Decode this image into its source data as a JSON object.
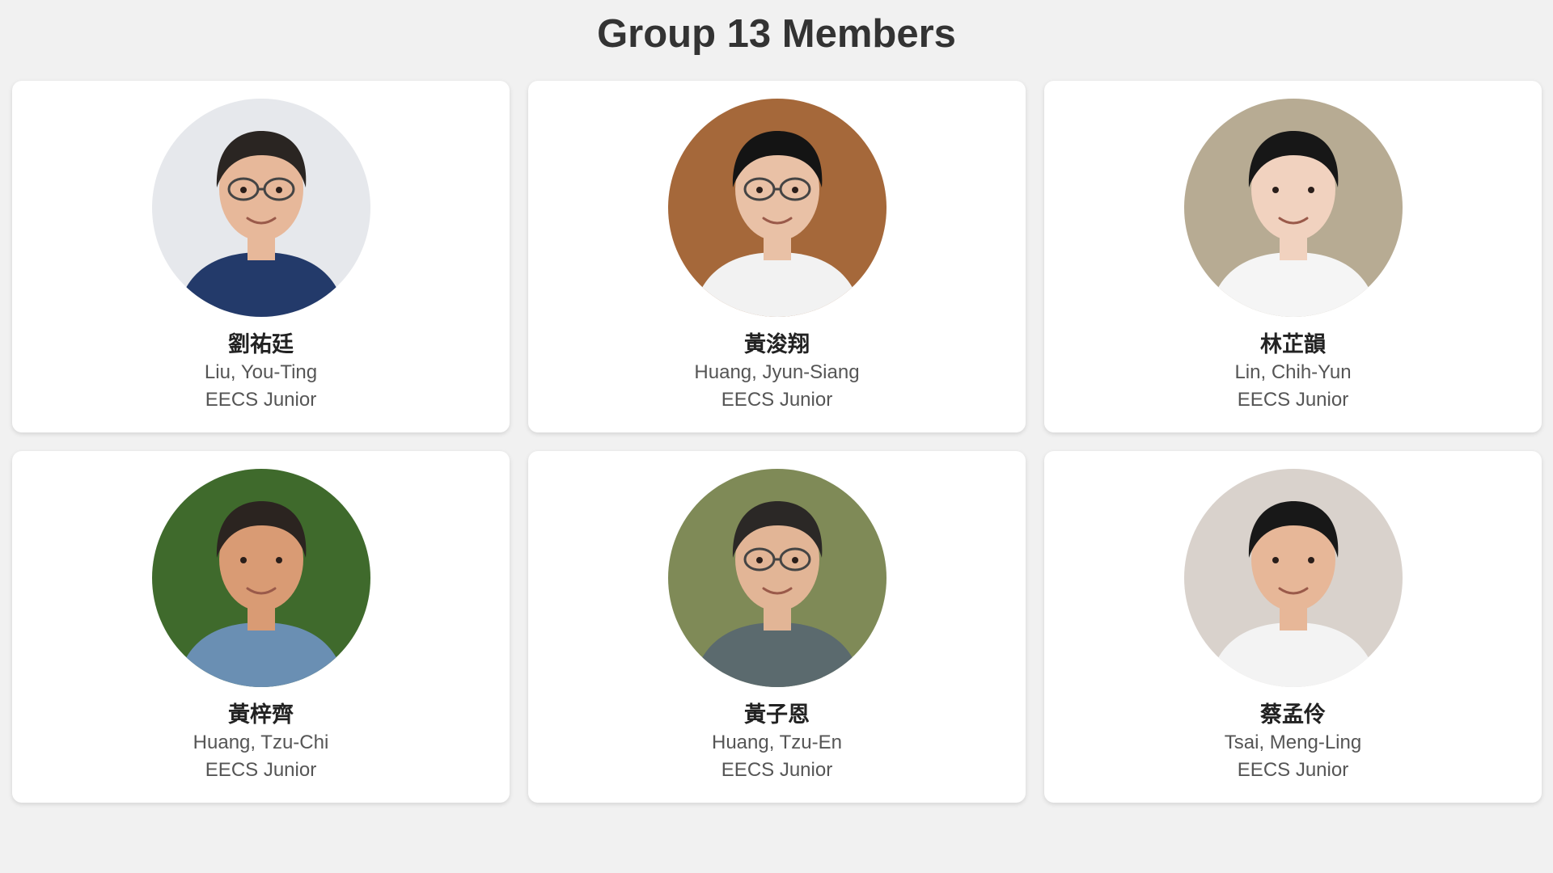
{
  "page": {
    "title": "Group 13 Members"
  },
  "members": [
    {
      "name_zh": "劉祐廷",
      "name_en": "Liu, You-Ting",
      "dept": "EECS Junior",
      "photo": {
        "bg": "#e6e8ec",
        "skin": "#e7b89a",
        "hair": "#2a2522",
        "shirt": "#233a6a",
        "glasses": true
      }
    },
    {
      "name_zh": "黃浚翔",
      "name_en": "Huang, Jyun-Siang",
      "dept": "EECS Junior",
      "photo": {
        "bg": "#a5683a",
        "skin": "#e9c1a6",
        "hair": "#141414",
        "shirt": "#f2f2f2",
        "glasses": true
      }
    },
    {
      "name_zh": "林芷韻",
      "name_en": "Lin, Chih-Yun",
      "dept": "EECS Junior",
      "photo": {
        "bg": "#b7ab93",
        "skin": "#f1d2bf",
        "hair": "#171717",
        "shirt": "#f5f5f5",
        "glasses": false
      }
    },
    {
      "name_zh": "黃梓齊",
      "name_en": "Huang, Tzu-Chi",
      "dept": "EECS Junior",
      "photo": {
        "bg": "#3f6a2c",
        "skin": "#d99b74",
        "hair": "#2b2420",
        "shirt": "#6a8fb3",
        "glasses": false
      }
    },
    {
      "name_zh": "黃子恩",
      "name_en": "Huang, Tzu-En",
      "dept": "EECS Junior",
      "photo": {
        "bg": "#7f8a57",
        "skin": "#e2b596",
        "hair": "#2b2826",
        "shirt": "#5b6a6e",
        "glasses": true
      }
    },
    {
      "name_zh": "蔡孟伶",
      "name_en": "Tsai, Meng-Ling",
      "dept": "EECS Junior",
      "photo": {
        "bg": "#d9d2cc",
        "skin": "#e7b798",
        "hair": "#181818",
        "shirt": "#f3f3f3",
        "glasses": false
      }
    }
  ]
}
